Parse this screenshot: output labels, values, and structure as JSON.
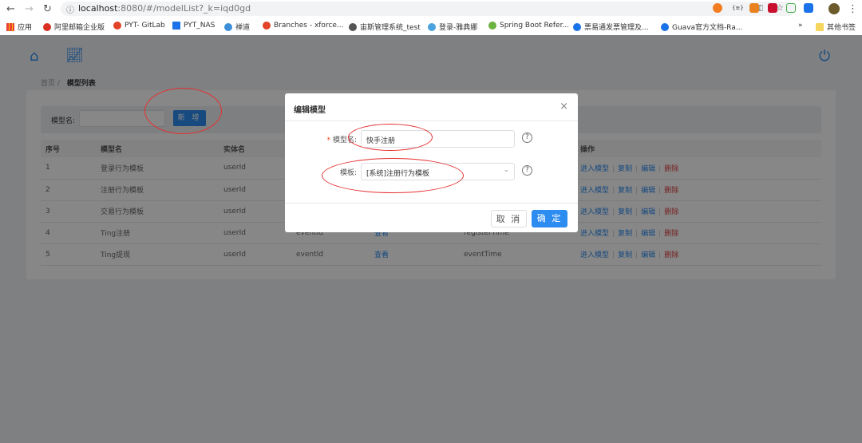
{
  "browser": {
    "url_host": "localhost",
    "url_rest": ":8080/#/modelList?_k=iqd0gd",
    "bookmarks": [
      {
        "label": "应用",
        "color": "#e94235"
      },
      {
        "label": "阿里邮箱企业版",
        "color": "#d93025"
      },
      {
        "label": "PYT- GitLab",
        "color": "#e24329"
      },
      {
        "label": "PYT_NAS",
        "color": "#1a73e8"
      },
      {
        "label": "禅道",
        "color": "#3d8fd9"
      },
      {
        "label": "Branches - xforce...",
        "color": "#e24329"
      },
      {
        "label": "宙斯管理系统_test",
        "color": "#555555"
      },
      {
        "label": "登录-雅典娜",
        "color": "#4aa3df"
      },
      {
        "label": "Spring Boot Refer...",
        "color": "#6db33f"
      },
      {
        "label": "票易通发票管理及...",
        "color": "#1a73e8"
      },
      {
        "label": "Guava官方文档-Ra...",
        "color": "#1a73e8"
      }
    ],
    "more": "»",
    "other_bookmarks": "其他书签"
  },
  "breadcrumb": {
    "home": "首页",
    "current": "模型列表"
  },
  "search": {
    "label": "模型名:",
    "value": "",
    "add_button": "新 增"
  },
  "table": {
    "headers": [
      "序号",
      "模型名",
      "实体名",
      "",
      "",
      "",
      "操作"
    ],
    "rows": [
      {
        "no": "1",
        "name": "登录行为模板",
        "entity": "userId",
        "c4": "",
        "c5": "",
        "c6": ""
      },
      {
        "no": "2",
        "name": "注册行为模板",
        "entity": "userId",
        "c4": "",
        "c5": "",
        "c6": ""
      },
      {
        "no": "3",
        "name": "交易行为模板",
        "entity": "userId",
        "c4": "",
        "c5": "",
        "c6": ""
      },
      {
        "no": "4",
        "name": "Ting注册",
        "entity": "userId",
        "c4": "eventId",
        "c5": "查看",
        "c6": "registerTime"
      },
      {
        "no": "5",
        "name": "Ting提现",
        "entity": "userId",
        "c4": "eventId",
        "c5": "查看",
        "c6": "eventTime"
      }
    ],
    "actions": {
      "enter": "进入模型",
      "copy": "复制",
      "edit": "编辑",
      "delete": "删除"
    }
  },
  "modal": {
    "title": "编辑模型",
    "close": "×",
    "required_mark": "*",
    "name_label": "模型名:",
    "name_value": "快手注册",
    "template_label": "模板:",
    "template_value": "[系统]注册行为模板",
    "help": "?",
    "cancel": "取 消",
    "confirm": "确 定"
  },
  "colors": {
    "primary": "#2d8cf0",
    "danger": "#e04040",
    "annotation": "#e53030"
  }
}
